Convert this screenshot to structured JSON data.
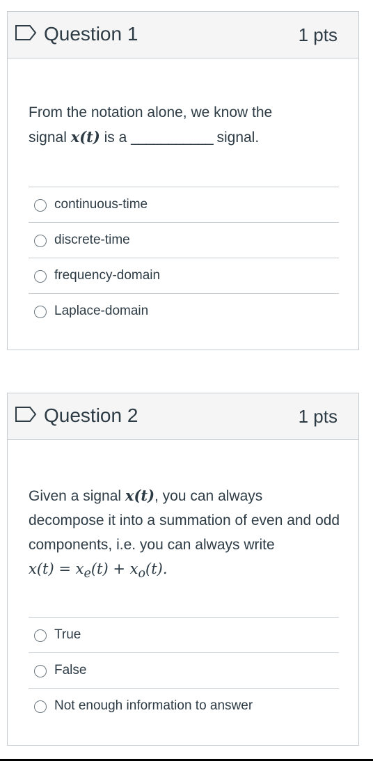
{
  "questions": [
    {
      "title": "Question 1",
      "points": "1 pts",
      "prompt": {
        "line1": "From the notation alone, we know the",
        "line2_prefix": "signal ",
        "math": "x(t)",
        "line2_mid": " is a ",
        "blank": "___________",
        "line2_suffix": " signal."
      },
      "answers": [
        "continuous-time",
        "discrete-time",
        "frequency-domain",
        "Laplace-domain"
      ]
    },
    {
      "title": "Question 2",
      "points": "1 pts",
      "prompt": {
        "part1": "Given a signal ",
        "math1": "x(t)",
        "part2": ", you can always decompose it into a summation of even and odd components, i.e. you can always write",
        "eq_lhs": "x(t) = x",
        "eq_sub_e": "e",
        "eq_mid": "(t) + x",
        "eq_sub_o": "o",
        "eq_end": "(t).",
        "eq_text": "x(t) = xe(t) + xo(t)."
      },
      "answers": [
        "True",
        "False",
        "Not enough information to answer"
      ]
    }
  ],
  "icons": {
    "flag": "flag-icon",
    "radio": "radio-icon"
  },
  "colors": {
    "text": "#2d3b45",
    "border": "#c7cdd1",
    "header_bg": "#f5f5f5"
  }
}
